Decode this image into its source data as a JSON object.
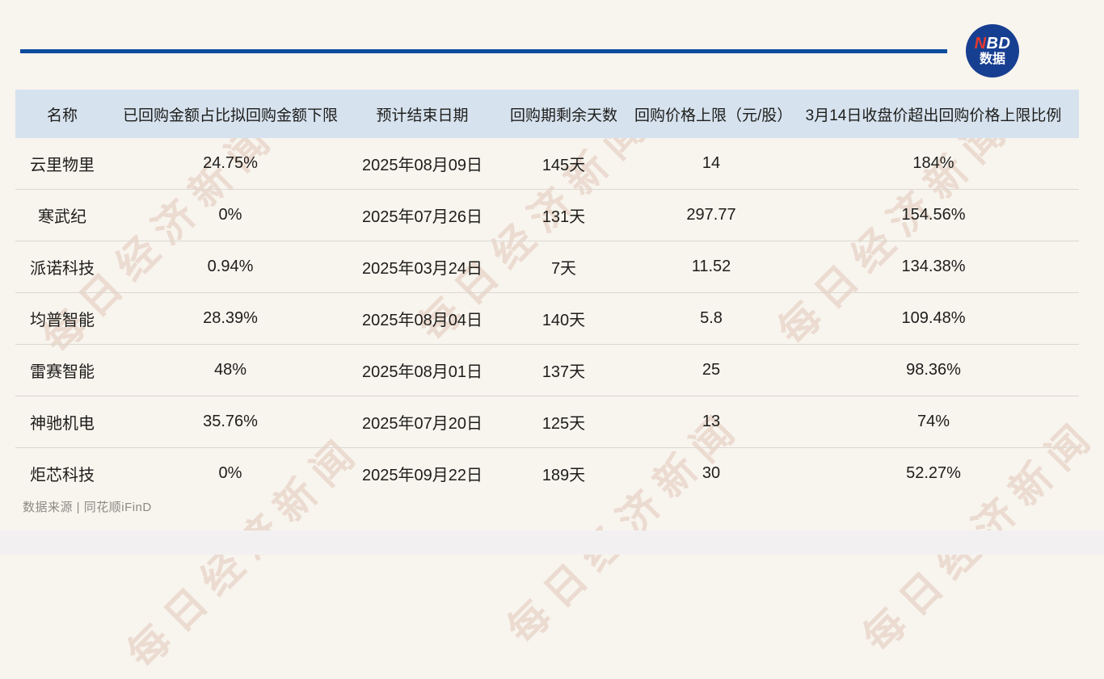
{
  "brand": {
    "logo_text_red": "N",
    "logo_text_white": "BD",
    "logo_subtext": "数据"
  },
  "watermark": {
    "text": "每日经济新闻"
  },
  "chart_data": {
    "type": "table",
    "columns": [
      "名称",
      "已回购金额占比拟回购金额下限",
      "预计结束日期",
      "回购期剩余天数",
      "回购价格上限（元/股）",
      "3月14日收盘价超出回购价格上限比例"
    ],
    "rows": [
      [
        "云里物里",
        "24.75%",
        "2025年08月09日",
        "145天",
        "14",
        "184%"
      ],
      [
        "寒武纪",
        "0%",
        "2025年07月26日",
        "131天",
        "297.77",
        "154.56%"
      ],
      [
        "派诺科技",
        "0.94%",
        "2025年03月24日",
        "7天",
        "11.52",
        "134.38%"
      ],
      [
        "均普智能",
        "28.39%",
        "2025年08月04日",
        "140天",
        "5.8",
        "109.48%"
      ],
      [
        "雷赛智能",
        "48%",
        "2025年08月01日",
        "137天",
        "25",
        "98.36%"
      ],
      [
        "神驰机电",
        "35.76%",
        "2025年07月20日",
        "125天",
        "13",
        "74%"
      ],
      [
        "炬芯科技",
        "0%",
        "2025年09月22日",
        "189天",
        "30",
        "52.27%"
      ]
    ]
  },
  "footer": {
    "source_label": "数据来源 | 同花顺iFinD"
  },
  "colors": {
    "page-bg": "#f8f4ee",
    "header-bg": "#d6e2ee",
    "rule-blue": "#0b4c9e",
    "logo-blue": "#173f91",
    "logo-red": "#e6392d",
    "text-dark": "#1d1d1b",
    "row-line": "#dcd8d1",
    "footer-gray": "#8d8a84",
    "watermark": "rgba(190,132,104,0.22)",
    "bottom-strip": "#f3f0f1"
  }
}
